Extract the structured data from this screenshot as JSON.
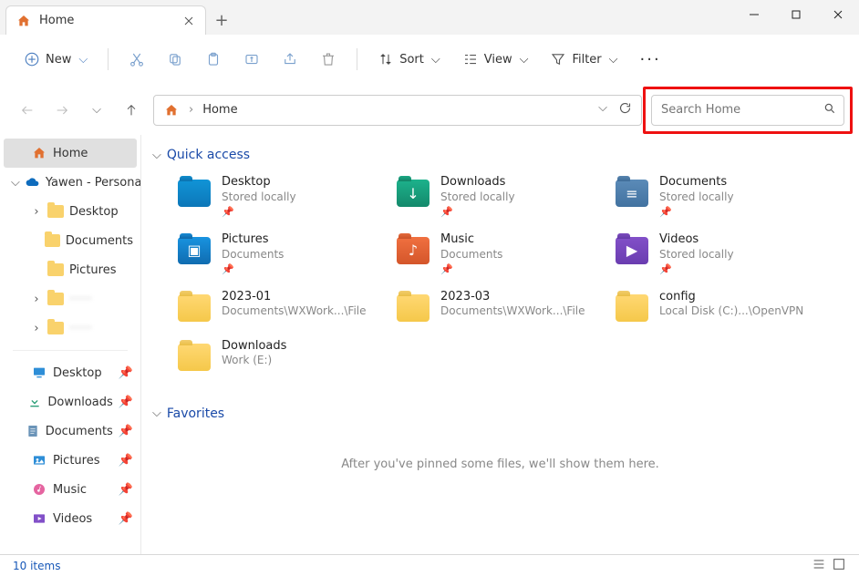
{
  "window": {
    "tab_title": "Home",
    "new_tab": "+"
  },
  "toolbar": {
    "new_label": "New",
    "sort_label": "Sort",
    "view_label": "View",
    "filter_label": "Filter"
  },
  "address": {
    "crumb": "Home",
    "search_placeholder": "Search Home"
  },
  "sidebar": {
    "home": "Home",
    "onedrive": "Yawen - Personal",
    "tree": [
      {
        "label": "Desktop"
      },
      {
        "label": "Documents"
      },
      {
        "label": "Pictures"
      },
      {
        "label": "······",
        "blur": true
      },
      {
        "label": "······",
        "blur": true
      }
    ],
    "pins": [
      {
        "label": "Desktop",
        "icon": "desktop"
      },
      {
        "label": "Downloads",
        "icon": "download"
      },
      {
        "label": "Documents",
        "icon": "document"
      },
      {
        "label": "Pictures",
        "icon": "pictures"
      },
      {
        "label": "Music",
        "icon": "music"
      },
      {
        "label": "Videos",
        "icon": "videos"
      }
    ]
  },
  "sections": {
    "quick_access": "Quick access",
    "favorites": "Favorites"
  },
  "quick_items": [
    {
      "name": "Desktop",
      "sub": "Stored locally",
      "pin": true,
      "icon": "qa-desktop",
      "glyph": ""
    },
    {
      "name": "Downloads",
      "sub": "Stored locally",
      "pin": true,
      "icon": "qa-dl",
      "glyph": "↓"
    },
    {
      "name": "Documents",
      "sub": "Stored locally",
      "pin": true,
      "icon": "qa-doc",
      "glyph": "≡"
    },
    {
      "name": "Pictures",
      "sub": "Documents",
      "pin": true,
      "icon": "qa-pic",
      "glyph": "▣"
    },
    {
      "name": "Music",
      "sub": "Documents",
      "pin": true,
      "icon": "qa-music",
      "glyph": "♪"
    },
    {
      "name": "Videos",
      "sub": "Stored locally",
      "pin": true,
      "icon": "qa-vid",
      "glyph": "▶"
    },
    {
      "name": "2023-01",
      "sub": "Documents\\WXWork...\\File",
      "pin": false,
      "icon": "qa-folder",
      "glyph": ""
    },
    {
      "name": "2023-03",
      "sub": "Documents\\WXWork...\\File",
      "pin": false,
      "icon": "qa-folder",
      "glyph": ""
    },
    {
      "name": "config",
      "sub": "Local Disk (C:)...\\OpenVPN",
      "pin": false,
      "icon": "qa-folder",
      "glyph": ""
    },
    {
      "name": "Downloads",
      "sub": "Work (E:)",
      "pin": false,
      "icon": "qa-green",
      "glyph": ""
    }
  ],
  "favorites_empty": "After you've pinned some files, we'll show them here.",
  "statusbar": {
    "count": "10 items"
  }
}
